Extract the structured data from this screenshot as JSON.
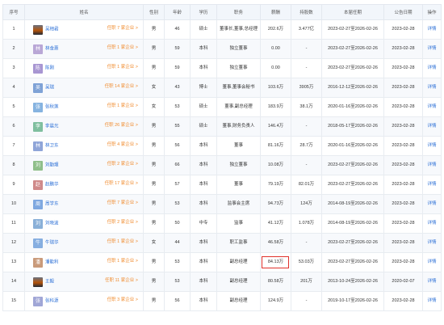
{
  "headers": [
    "序号",
    "姓名",
    "性别",
    "年龄",
    "学历",
    "职务",
    "薪酬",
    "持股数",
    "本届任期",
    "公告日期",
    "操作"
  ],
  "rows": [
    {
      "no": "1",
      "name": "吴相君",
      "avatar_text": "",
      "avatar_color": "",
      "has_photo": true,
      "pos_link": "任职 7 家企业 >",
      "gender": "男",
      "age": "46",
      "edu": "硕士",
      "title": "董事长,董事,总经理",
      "pay": "202.6万",
      "shares": "3.477亿",
      "term": "2023-02-27至2026-02-26",
      "date": "2023-02-28",
      "action": "详情"
    },
    {
      "no": "2",
      "name": "林金惠",
      "avatar_text": "林",
      "avatar_color": "#b9a7d6",
      "has_photo": false,
      "pos_link": "任职 1 家企业 >",
      "gender": "男",
      "age": "59",
      "edu": "本科",
      "title": "独立董事",
      "pay": "0.00",
      "shares": "-",
      "term": "2023-02-27至2026-02-26",
      "date": "2023-02-28",
      "action": "详情"
    },
    {
      "no": "3",
      "name": "陈刚",
      "avatar_text": "陈",
      "avatar_color": "#a896d2",
      "has_photo": false,
      "pos_link": "任职 1 家企业 >",
      "gender": "男",
      "age": "59",
      "edu": "本科",
      "title": "独立董事",
      "pay": "0.00",
      "shares": "-",
      "term": "2023-02-27至2026-02-26",
      "date": "2023-02-28",
      "action": "详情"
    },
    {
      "no": "4",
      "name": "吴瑞",
      "avatar_text": "吴",
      "avatar_color": "#7fa2d6",
      "has_photo": false,
      "pos_link": "任职 14 家企业 >",
      "gender": "女",
      "age": "43",
      "edu": "博士",
      "title": "董事,董事会秘书",
      "pay": "103.6万",
      "shares": "3905万",
      "term": "2016-12-12至2026-02-26",
      "date": "2023-02-28",
      "action": "详情"
    },
    {
      "no": "5",
      "name": "张秋莲",
      "avatar_text": "张",
      "avatar_color": "#86b3e0",
      "has_photo": false,
      "pos_link": "任职 1 家企业 >",
      "gender": "女",
      "age": "53",
      "edu": "硕士",
      "title": "董事,副总经理",
      "pay": "183.9万",
      "shares": "38.1万",
      "term": "2020-01-16至2026-02-26",
      "date": "2023-02-28",
      "action": "详情"
    },
    {
      "no": "6",
      "name": "李晨光",
      "avatar_text": "李",
      "avatar_color": "#7fbf9f",
      "has_photo": false,
      "pos_link": "任职 26 家企业 >",
      "gender": "男",
      "age": "55",
      "edu": "硕士",
      "title": "董事,财务负责人",
      "pay": "146.4万",
      "shares": "-",
      "term": "2018-05-17至2026-02-26",
      "date": "2023-02-28",
      "action": "详情"
    },
    {
      "no": "7",
      "name": "林卫东",
      "avatar_text": "林",
      "avatar_color": "#8fa5d8",
      "has_photo": false,
      "pos_link": "任职 4 家企业 >",
      "gender": "男",
      "age": "56",
      "edu": "本科",
      "title": "董事",
      "pay": "81.16万",
      "shares": "28.7万",
      "term": "2020-01-16至2026-02-26",
      "date": "2023-02-28",
      "action": "详情"
    },
    {
      "no": "8",
      "name": "刘勤理",
      "avatar_text": "刘",
      "avatar_color": "#8fbf8a",
      "has_photo": false,
      "pos_link": "任职 2 家企业 >",
      "gender": "男",
      "age": "66",
      "edu": "本科",
      "title": "独立董事",
      "pay": "10.08万",
      "shares": "-",
      "term": "2023-02-27至2026-02-26",
      "date": "2023-02-28",
      "action": "详情"
    },
    {
      "no": "9",
      "name": "赵鹏华",
      "avatar_text": "赵",
      "avatar_color": "#d08a8a",
      "has_photo": false,
      "pos_link": "任职 17 家企业 >",
      "gender": "男",
      "age": "57",
      "edu": "本科",
      "title": "董事",
      "pay": "79.19万",
      "shares": "82.01万",
      "term": "2023-02-27至2026-02-26",
      "date": "2023-02-28",
      "action": "详情"
    },
    {
      "no": "10",
      "name": "周学东",
      "avatar_text": "周",
      "avatar_color": "#7fa8e0",
      "has_photo": false,
      "pos_link": "任职 7 家企业 >",
      "gender": "男",
      "age": "53",
      "edu": "本科",
      "title": "监事会主席",
      "pay": "94.73万",
      "shares": "124万",
      "term": "2014-08-19至2026-02-26",
      "date": "2023-02-28",
      "action": "详情"
    },
    {
      "no": "11",
      "name": "刘晓波",
      "avatar_text": "刘",
      "avatar_color": "#8ab0d8",
      "has_photo": false,
      "pos_link": "任职 2 家企业 >",
      "gender": "男",
      "age": "50",
      "edu": "中专",
      "title": "监事",
      "pay": "41.12万",
      "shares": "1.078万",
      "term": "2014-08-19至2026-02-26",
      "date": "2023-02-28",
      "action": "详情"
    },
    {
      "no": "12",
      "name": "牛瑞华",
      "avatar_text": "牛",
      "avatar_color": "#86aee0",
      "has_photo": false,
      "pos_link": "任职 1 家企业 >",
      "gender": "女",
      "age": "44",
      "edu": "本科",
      "title": "职工监事",
      "pay": "46.58万",
      "shares": "-",
      "term": "2023-02-27至2026-02-26",
      "date": "2023-02-28",
      "action": "详情"
    },
    {
      "no": "13",
      "name": "潘能利",
      "avatar_text": "潘",
      "avatar_color": "#c99a7a",
      "has_photo": false,
      "pos_link": "任职 1 家企业 >",
      "gender": "男",
      "age": "53",
      "edu": "本科",
      "title": "副总经理",
      "pay": "84.13万",
      "shares": "53.03万",
      "term": "2023-02-27至2026-02-26",
      "date": "2023-02-28",
      "action": "详情",
      "highlight_pay": true
    },
    {
      "no": "14",
      "name": "王毅",
      "avatar_text": "",
      "avatar_color": "",
      "has_photo": true,
      "pos_link": "任职 11 家企业 >",
      "gender": "男",
      "age": "53",
      "edu": "本科",
      "title": "副总经理",
      "pay": "80.58万",
      "shares": "201万",
      "term": "2013-10-24至2026-02-26",
      "date": "2020-02-07",
      "action": "详情"
    },
    {
      "no": "15",
      "name": "张科源",
      "avatar_text": "张",
      "avatar_color": "#a0a6d6",
      "has_photo": false,
      "pos_link": "任职 3 家企业 >",
      "gender": "男",
      "age": "56",
      "edu": "本科",
      "title": "副总经理",
      "pay": "124.9万",
      "shares": "-",
      "term": "2019-10-17至2026-02-26",
      "date": "2023-02-28",
      "action": "详情"
    }
  ],
  "colors": {
    "link": "#2b6fd6",
    "accent": "#f08a2c",
    "highlight": "#e0312b",
    "header_bg": "#f2f6fb"
  }
}
